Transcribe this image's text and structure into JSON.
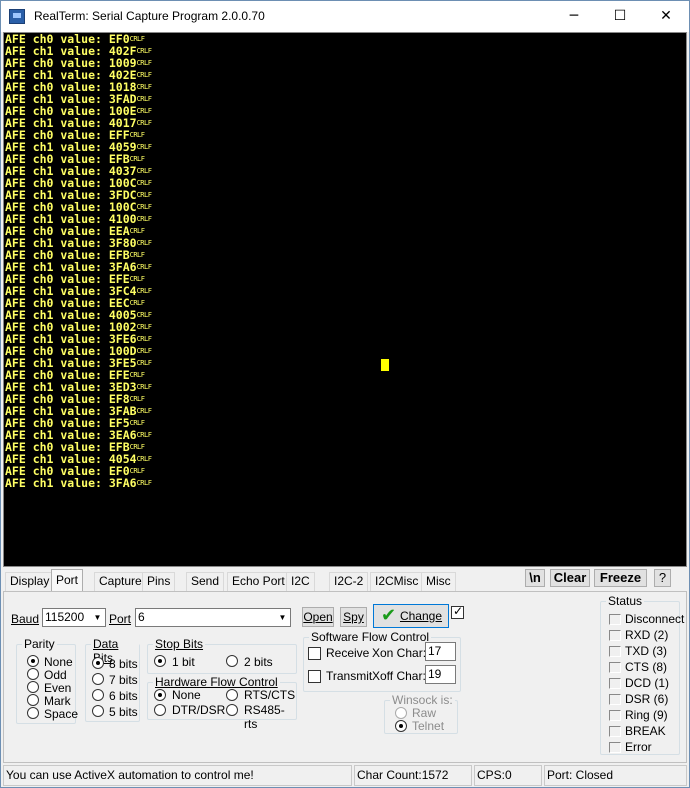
{
  "window": {
    "title": "RealTerm: Serial Capture Program 2.0.0.70",
    "minimize": "─",
    "maximize": "☐",
    "close": "✕"
  },
  "terminal": {
    "crlf": "CRLF",
    "lines": [
      "AFE ch0 value: EF0",
      "AFE ch1 value: 402F",
      "AFE ch0 value: 1009",
      "AFE ch1 value: 402E",
      "AFE ch0 value: 1018",
      "AFE ch1 value: 3FAD",
      "AFE ch0 value: 100E",
      "AFE ch1 value: 4017",
      "AFE ch0 value: EFF",
      "AFE ch1 value: 4059",
      "AFE ch0 value: EFB",
      "AFE ch1 value: 4037",
      "AFE ch0 value: 100C",
      "AFE ch1 value: 3FDC",
      "AFE ch0 value: 100C",
      "AFE ch1 value: 4100",
      "AFE ch0 value: EEA",
      "AFE ch1 value: 3F80",
      "AFE ch0 value: EFB",
      "AFE ch1 value: 3FA6",
      "AFE ch0 value: EFE",
      "AFE ch1 value: 3FC4",
      "AFE ch0 value: EEC",
      "AFE ch1 value: 4005",
      "AFE ch0 value: 1002",
      "AFE ch1 value: 3FE6",
      "AFE ch0 value: 100D",
      "AFE ch1 value: 3FE5",
      "AFE ch0 value: EFE",
      "AFE ch1 value: 3ED3",
      "AFE ch0 value: EF8",
      "AFE ch1 value: 3FAB",
      "AFE ch0 value: EF5",
      "AFE ch1 value: 3EA6",
      "AFE ch0 value: EFB",
      "AFE ch1 value: 4054",
      "AFE ch0 value: EF0",
      "AFE ch1 value: 3FA6"
    ],
    "text_color": "#ffff64",
    "background": "#000000"
  },
  "tabs": [
    "Display",
    "Port",
    "Capture",
    "Pins",
    "Send",
    "Echo Port",
    "I2C",
    "I2C-2",
    "I2CMisc",
    "Misc"
  ],
  "active_tab": "Port",
  "toolbar_right": {
    "newline": "\\n",
    "clear": "Clear",
    "freeze": "Freeze",
    "help": "?"
  },
  "port": {
    "baud_label": "Baud",
    "baud_value": "115200",
    "port_label": "Port",
    "port_value": "6",
    "open": "Open",
    "spy": "Spy",
    "change": "Change",
    "parity": {
      "label": "Parity",
      "options": [
        "None",
        "Odd",
        "Even",
        "Mark",
        "Space"
      ],
      "selected": "None"
    },
    "data_bits": {
      "label": "Data Bits",
      "options": [
        "8 bits",
        "7 bits",
        "6 bits",
        "5 bits"
      ],
      "selected": "8 bits"
    },
    "stop_bits": {
      "label": "Stop Bits",
      "options": [
        "1 bit",
        "2 bits"
      ],
      "selected": "1 bit"
    },
    "hw_flow": {
      "label": "Hardware Flow Control",
      "options": [
        "None",
        "RTS/CTS",
        "DTR/DSR",
        "RS485-rts"
      ],
      "selected": "None"
    },
    "sw_flow": {
      "label": "Software Flow Control",
      "receive": "Receive",
      "transmit": "Transmit",
      "xon_label": "Xon Char:",
      "xon_value": "17",
      "xoff_label": "Xoff Char:",
      "xoff_value": "19"
    },
    "winsock": {
      "label": "Winsock is:",
      "options": [
        "Raw",
        "Telnet"
      ],
      "selected": "Telnet"
    }
  },
  "status_panel": {
    "label": "Status",
    "items": [
      "Disconnect",
      "RXD (2)",
      "TXD (3)",
      "CTS (8)",
      "DCD (1)",
      "DSR (6)",
      "Ring (9)",
      "BREAK",
      "Error"
    ]
  },
  "statusbar": {
    "message": "You can use ActiveX automation to control me!",
    "char_count": "Char Count:1572",
    "cps": "CPS:0",
    "port_state": "Port: Closed"
  }
}
